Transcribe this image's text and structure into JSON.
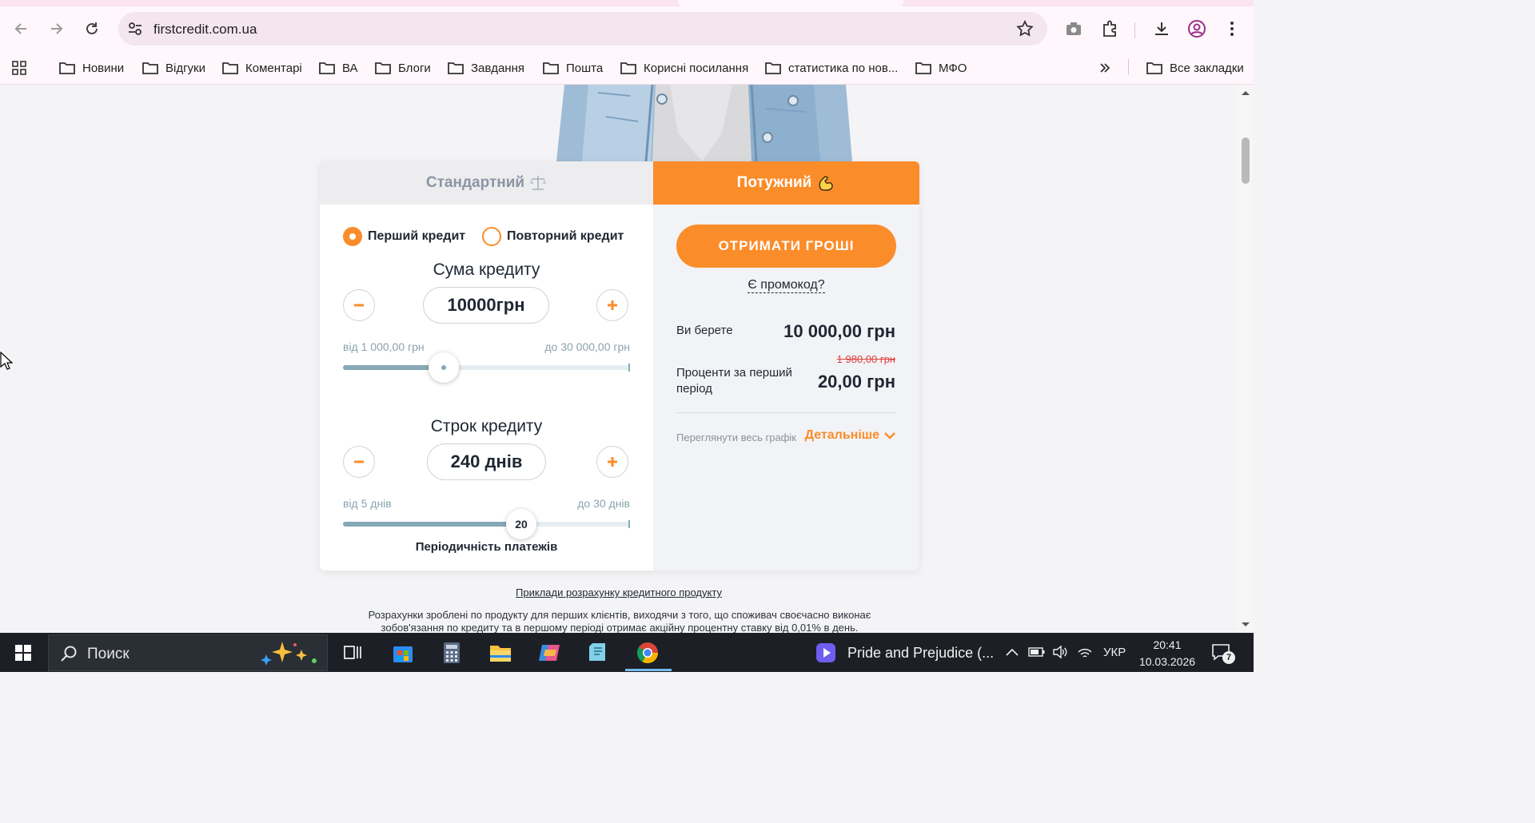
{
  "browser": {
    "url": "firstcredit.com.ua",
    "bookmarks": [
      "Новини",
      "Відгуки",
      "Коментарі",
      "ВА",
      "Блоги",
      "Завдання",
      "Пошта",
      "Корисні посилання",
      "статистика по нов...",
      "МФО"
    ],
    "all_bookmarks_label": "Все закладки"
  },
  "calculator": {
    "tabs": {
      "standard": "Стандартний",
      "powerful": "Потужний"
    },
    "radio": {
      "first": "Перший кредит",
      "repeat": "Повторний кредит",
      "selected": "first"
    },
    "amount": {
      "title": "Сума кредиту",
      "value": "10000грн",
      "min_label": "від 1 000,00 грн",
      "max_label": "до 30 000,00 грн",
      "fraction": 0.35
    },
    "term": {
      "title": "Строк кредиту",
      "value": "240 днів",
      "min_label": "від 5 днів",
      "max_label": "до 30 днів",
      "knob_value": "20",
      "fraction": 0.62,
      "periodicity_label": "Періодичність платежів"
    }
  },
  "summary": {
    "cta_label": "ОТРИМАТИ ГРОШІ",
    "promo_label": "Є промокод?",
    "you_take_label": "Ви берете",
    "you_take_value": "10 000,00 грн",
    "interest_label": "Проценти за перший період",
    "interest_old": "1 980,00 грн",
    "interest_value": "20,00 грн",
    "schedule_label": "Переглянути весь графік",
    "details_label": "Детальніше"
  },
  "footer": {
    "examples_link": "Приклади розрахунку кредитного продукту",
    "disclaimer": "Розрахунки зроблені по продукту для перших клієнтів, виходячи з того, що споживач своєчасно виконає зобов'язання по кредиту та в першому періоді отримає акційну процентну ставку від 0,01% в день."
  },
  "taskbar": {
    "search_placeholder": "Поиск",
    "media_title": "Pride and Prejudice (...",
    "language": "УКР",
    "time": "20:41",
    "date": "10.03.2026",
    "notifications": "7"
  },
  "colors": {
    "accent": "#fb8c2a",
    "slider": "#85a9b6",
    "old_price": "#e0403c"
  }
}
